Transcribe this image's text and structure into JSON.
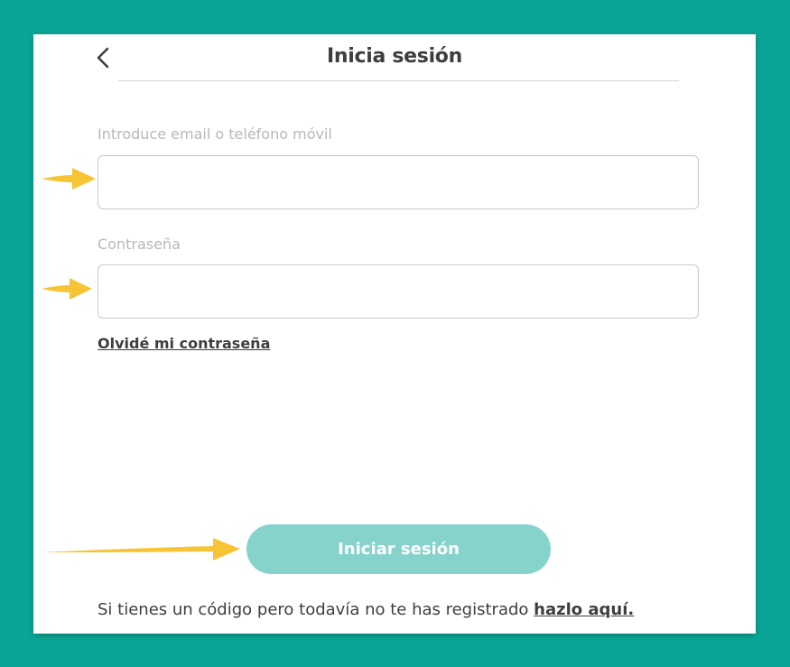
{
  "header": {
    "title": "Inicia sesión"
  },
  "form": {
    "email": {
      "label": "Introduce email o teléfono móvil",
      "value": ""
    },
    "password": {
      "label": "Contraseña",
      "value": ""
    },
    "forgot_label": "Olvidé mi contraseña",
    "submit_label": "Iniciar sesión"
  },
  "footer": {
    "register_text": "Si tienes un código pero todavía no te has registrado",
    "register_link": "hazlo aquí."
  },
  "colors": {
    "background": "#0aa596",
    "button": "#86d3cb",
    "arrow": "#f7c436",
    "text": "#3e3e3e"
  },
  "icons": {
    "back": "chevron-left-icon",
    "annotation": "arrow-right-icon"
  }
}
